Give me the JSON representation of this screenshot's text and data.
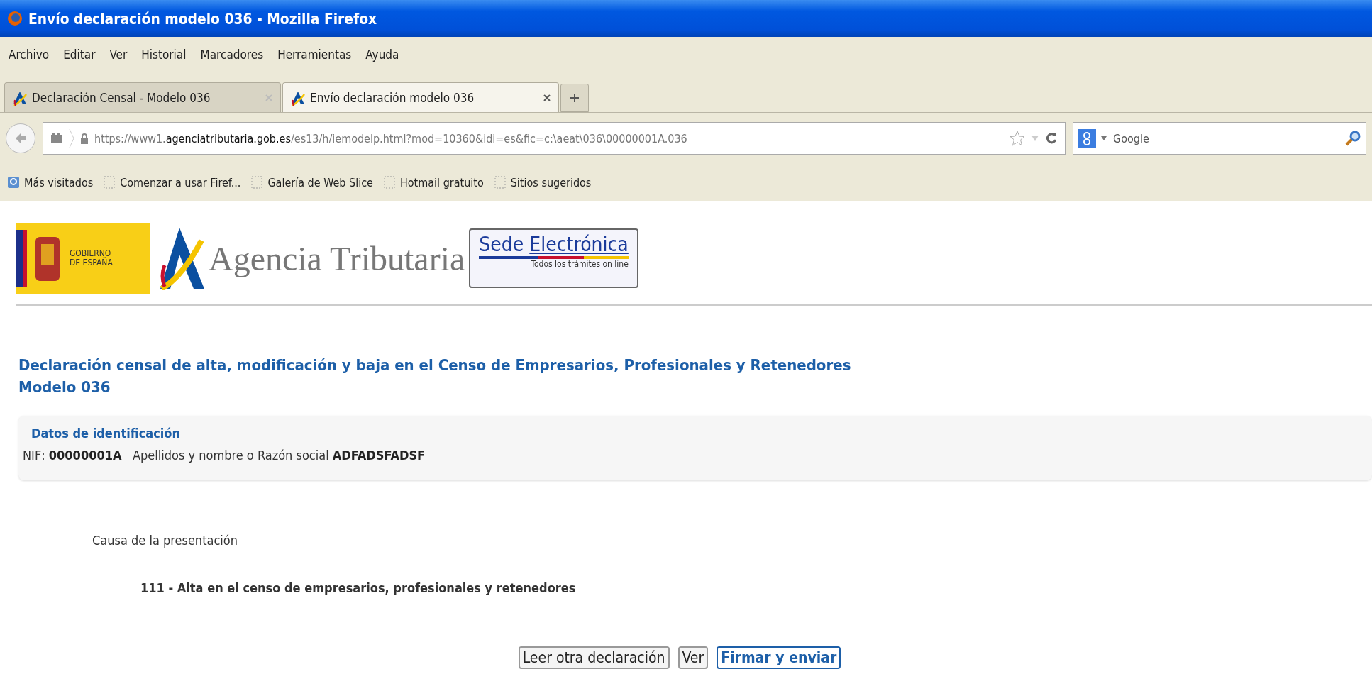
{
  "window": {
    "title": "Envío declaración modelo 036 - Mozilla Firefox"
  },
  "menu": [
    "Archivo",
    "Editar",
    "Ver",
    "Historial",
    "Marcadores",
    "Herramientas",
    "Ayuda"
  ],
  "tabs": [
    {
      "label": "Declaración Censal - Modelo 036",
      "selected": false
    },
    {
      "label": "Envío declaración modelo 036",
      "selected": true
    }
  ],
  "address_bar": {
    "host_prefix": "https://www1.",
    "host": "agenciatributaria.gob.es",
    "path": "/es13/h/iemodelp.html?mod=10360&idi=es&fic=c:\\aeat\\036\\00000001A.036"
  },
  "search": {
    "placeholder": "Google"
  },
  "bookmarks": [
    "Más visitados",
    "Comenzar a usar Firef...",
    "Galería de Web Slice",
    "Hotmail gratuito",
    "Sitios sugeridos"
  ],
  "header": {
    "gov_logo": "GOBIERNO\nDE ESPAÑA",
    "agency": "Agencia Tributaria",
    "sede_title_1": "Sede ",
    "sede_title_2": "Electrónica",
    "sede_subtitle": "Todos los trámites on line"
  },
  "page": {
    "title": "Declaración censal de alta, modificación y baja en el Censo de Empresarios, Profesionales y Retenedores",
    "subtitle": "Modelo 036"
  },
  "identification": {
    "heading": "Datos de identificación",
    "nif_label": "NIF",
    "text": ": **00000001A**   Apellidos y nombre o Razón social **ADFADSFADSF**"
  },
  "cause": {
    "label": "Causa de la presentación",
    "value": "111 - Alta en el censo de empresarios, profesionales y retenedores"
  },
  "buttons": [
    {
      "label": "Leer otra declaración",
      "kind": "normal"
    },
    {
      "label": "Ver",
      "kind": "normal"
    },
    {
      "label": "Firmar y enviar",
      "kind": "primary"
    }
  ]
}
